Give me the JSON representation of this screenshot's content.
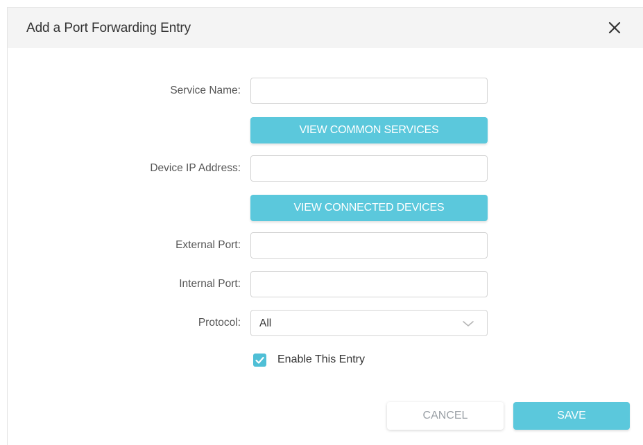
{
  "dialog": {
    "title": "Add a Port Forwarding Entry",
    "close_icon": "close-icon"
  },
  "form": {
    "service_name": {
      "label": "Service Name:",
      "value": ""
    },
    "view_common_services": {
      "label": "VIEW COMMON SERVICES"
    },
    "device_ip": {
      "label": "Device IP Address:",
      "value": ""
    },
    "view_connected_devices": {
      "label": "VIEW CONNECTED DEVICES"
    },
    "external_port": {
      "label": "External Port:",
      "value": ""
    },
    "internal_port": {
      "label": "Internal Port:",
      "value": ""
    },
    "protocol": {
      "label": "Protocol:",
      "selected": "All",
      "icon": "chevron-down-icon"
    },
    "enable_entry": {
      "label": "Enable This Entry",
      "checked": true,
      "icon": "checkmark-icon"
    }
  },
  "actions": {
    "cancel_label": "CANCEL",
    "save_label": "SAVE"
  },
  "colors": {
    "accent": "#5bc8dc",
    "header_bg": "#f4f4f4",
    "cancel_text": "#9aa0a6"
  }
}
